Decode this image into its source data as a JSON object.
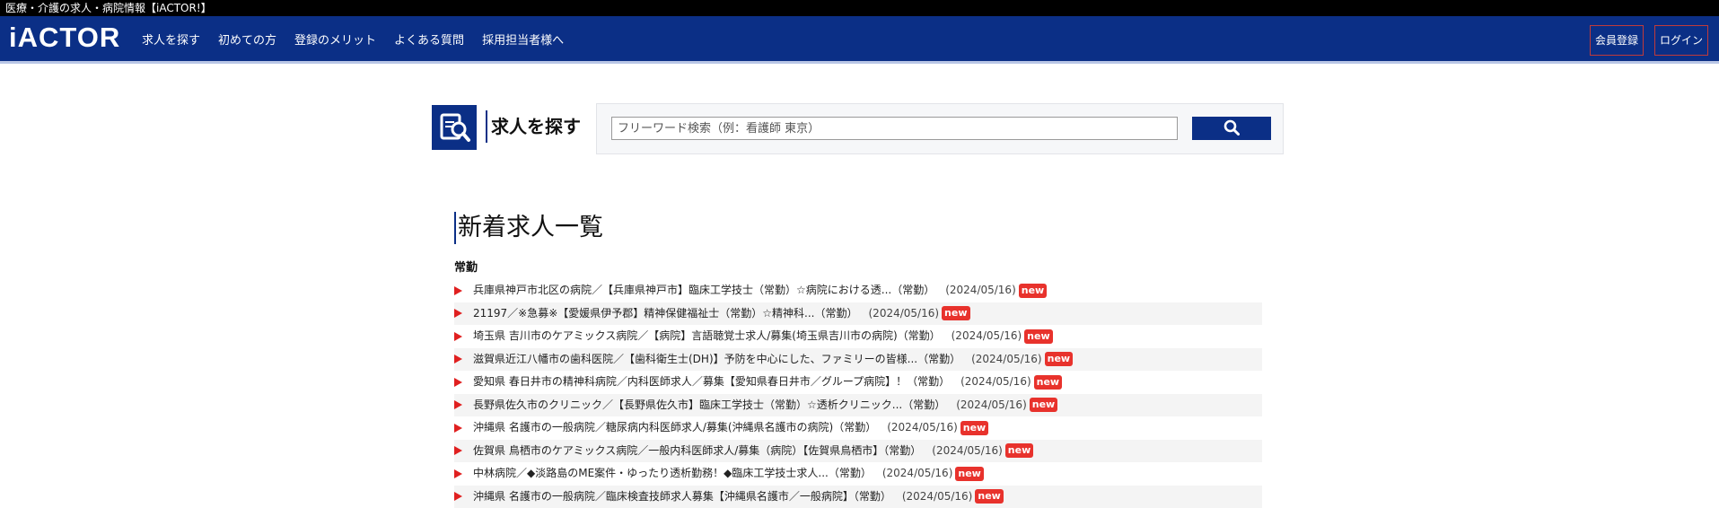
{
  "window": {
    "title": "医療・介護の求人・病院情報【iACTOR!】"
  },
  "header": {
    "logo": "iACTOR",
    "nav": [
      "求人を探す",
      "初めての方",
      "登録のメリット",
      "よくある質問",
      "採用担当者様へ"
    ],
    "register_label": "会員登録",
    "login_label": "ログイン"
  },
  "search": {
    "title": "求人を探す",
    "placeholder": "フリーワード検索（例：看護師 東京）",
    "button_icon": "search-icon"
  },
  "listing": {
    "title": "新着求人一覧",
    "category": "常勤",
    "items": [
      {
        "title": "兵庫県神戸市北区の病院／【兵庫県神戸市】臨床工学技士（常勤）☆病院における透...（常勤）",
        "date": "(2024/05/16)",
        "badge": "new"
      },
      {
        "title": "21197／※急募※【愛媛県伊予郡】精神保健福祉士（常勤）☆精神科...（常勤）",
        "date": "(2024/05/16)",
        "badge": "new"
      },
      {
        "title": "埼玉県 吉川市のケアミックス病院／【病院】言語聴覚士求人/募集(埼玉県吉川市の病院)（常勤）",
        "date": "(2024/05/16)",
        "badge": "new"
      },
      {
        "title": "滋賀県近江八幡市の歯科医院／【歯科衛生士(DH)】予防を中心にした、ファミリーの皆様...（常勤）",
        "date": "(2024/05/16)",
        "badge": "new"
      },
      {
        "title": "愛知県 春日井市の精神科病院／内科医師求人／募集【愛知県春日井市／グループ病院】！（常勤）",
        "date": "(2024/05/16)",
        "badge": "new"
      },
      {
        "title": "長野県佐久市のクリニック／【長野県佐久市】臨床工学技士（常勤）☆透析クリニック...（常勤）",
        "date": "(2024/05/16)",
        "badge": "new"
      },
      {
        "title": "沖縄県 名護市の一般病院／糖尿病内科医師求人/募集(沖縄県名護市の病院)（常勤）",
        "date": "(2024/05/16)",
        "badge": "new"
      },
      {
        "title": "佐賀県 鳥栖市のケアミックス病院／一般内科医師求人/募集（病院）【佐賀県鳥栖市】（常勤）",
        "date": "(2024/05/16)",
        "badge": "new"
      },
      {
        "title": "中林病院／◆淡路島のME案件・ゆったり透析勤務！◆臨床工学技士求人...（常勤）",
        "date": "(2024/05/16)",
        "badge": "new"
      },
      {
        "title": "沖縄県 名護市の一般病院／臨床検査技師求人募集【沖縄県名護市／一般病院】（常勤）",
        "date": "(2024/05/16)",
        "badge": "new"
      }
    ]
  },
  "colors": {
    "brand": "#0b2f86",
    "accent": "#e8322c",
    "arrow": "#e02020"
  }
}
